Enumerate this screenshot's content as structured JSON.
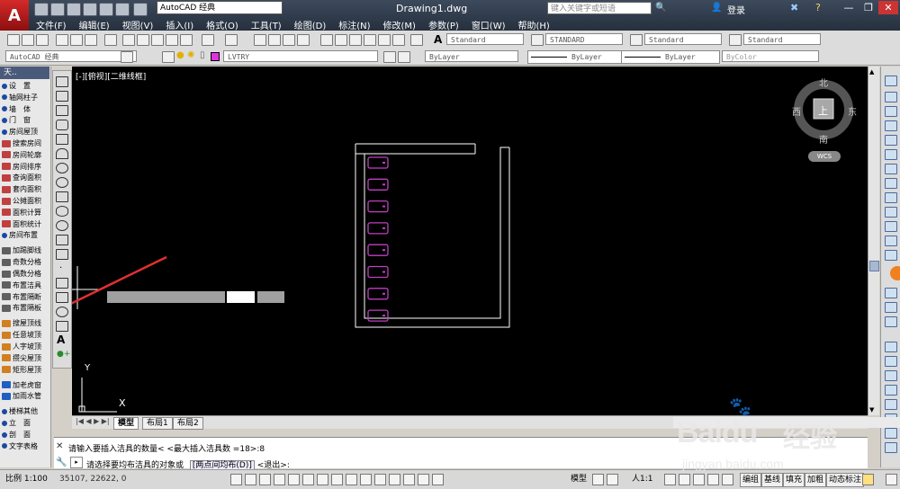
{
  "app": {
    "logo": "A",
    "workspace": "AutoCAD 经典",
    "document_title": "Drawing1.dwg",
    "search_placeholder": "键入关键字或短语",
    "login": "登录",
    "window_buttons": [
      "—",
      "❐",
      "✕"
    ]
  },
  "menus": [
    "文件(F)",
    "编辑(E)",
    "视图(V)",
    "插入(I)",
    "格式(O)",
    "工具(T)",
    "绘图(D)",
    "标注(N)",
    "修改(M)",
    "参数(P)",
    "窗口(W)",
    "帮助(H)"
  ],
  "toolbar_styles": {
    "text_style": "Standard",
    "dim_style": "STANDARD",
    "table_style": "Standard",
    "multileader_style": "Standard"
  },
  "toolbar_props": {
    "workspace2": "AutoCAD 经典",
    "layer": "LVTRY",
    "color": "ByLayer",
    "linetype": "ByLayer",
    "lineweight": "ByLayer",
    "plotstyle": "ByColor"
  },
  "palette": {
    "header": "天..",
    "items": [
      {
        "label": "设　置",
        "color": "#1a4aa0"
      },
      {
        "label": "轴网柱子",
        "color": "#1a4aa0"
      },
      {
        "label": "墙　体",
        "color": "#1a4aa0"
      },
      {
        "label": "门　窗",
        "color": "#1a4aa0"
      },
      {
        "label": "房间屋顶",
        "color": "#1a4aa0"
      },
      {
        "label": "搜索房间",
        "color": "#c04040"
      },
      {
        "label": "房间轮廓",
        "color": "#c04040"
      },
      {
        "label": "房间排序",
        "color": "#c04040"
      },
      {
        "label": "查询面积",
        "color": "#c04040"
      },
      {
        "label": "套内面积",
        "color": "#c04040"
      },
      {
        "label": "公摊面积",
        "color": "#c04040"
      },
      {
        "label": "面积计算",
        "color": "#c04040"
      },
      {
        "label": "面积统计",
        "color": "#c04040"
      },
      {
        "label": "房间布置",
        "color": "#1a4aa0"
      },
      {
        "label": "加踢脚线",
        "color": "#606060"
      },
      {
        "label": "奇数分格",
        "color": "#606060"
      },
      {
        "label": "偶数分格",
        "color": "#606060"
      },
      {
        "label": "布置洁具",
        "color": "#606060"
      },
      {
        "label": "布置隔断",
        "color": "#606060"
      },
      {
        "label": "布置隔板",
        "color": "#606060"
      },
      {
        "label": "搜屋顶线",
        "color": "#d08020"
      },
      {
        "label": "任意坡顶",
        "color": "#d08020"
      },
      {
        "label": "人字坡顶",
        "color": "#d08020"
      },
      {
        "label": "攒尖屋顶",
        "color": "#d08020"
      },
      {
        "label": "矩形屋顶",
        "color": "#d08020"
      },
      {
        "label": "加老虎窗",
        "color": "#2060c0"
      },
      {
        "label": "加雨水管",
        "color": "#2060c0"
      },
      {
        "label": "楼梯其他",
        "color": "#1a4aa0"
      },
      {
        "label": "立　面",
        "color": "#1a4aa0"
      },
      {
        "label": "剖　面",
        "color": "#1a4aa0"
      },
      {
        "label": "文字表格",
        "color": "#1a4aa0"
      }
    ]
  },
  "viewport": {
    "label": "[-][俯视][二维线框]"
  },
  "viewcube": {
    "north": "北",
    "south": "南",
    "east": "东",
    "west": "西",
    "top": "上",
    "wcs": "WCS"
  },
  "ucs": {
    "x": "X",
    "y": "Y"
  },
  "layout_tabs": [
    "模型",
    "布局1",
    "布局2"
  ],
  "command": {
    "line1": "请输入要插入洁具的数量< <最大插入洁具数 =18>:8",
    "line2_prefix": "请选择要均布洁具的对象或",
    "line2_option": "[两点间均布(D)]",
    "line2_suffix": "<退出>:"
  },
  "status": {
    "scale": "比例 1:100",
    "coords": "35107, 22622, 0",
    "model": "模型",
    "anno_scale": "人1:1",
    "items": [
      "编组",
      "基线",
      "填充",
      "加粗",
      "动态标注"
    ]
  },
  "watermark": {
    "brand": "Baidu",
    "cn": "经验",
    "url": "jingyan.baidu.com"
  },
  "colors": {
    "canvas": "#000000",
    "fixture": "#c040c0",
    "partition": "#ffffff",
    "arrow": "#e03030"
  },
  "fixtures": {
    "count": 8
  }
}
